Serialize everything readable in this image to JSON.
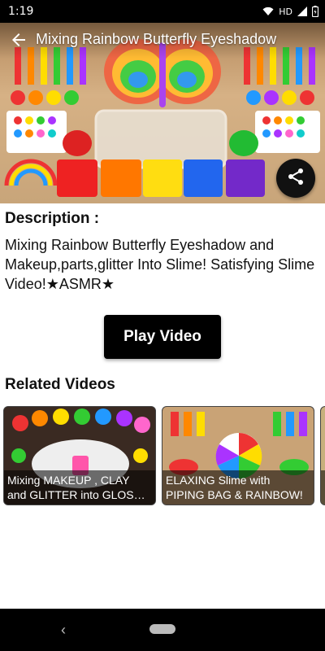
{
  "status_bar": {
    "time": "1:19",
    "network_label": "HD",
    "icons": [
      "wifi-icon",
      "hd-icon",
      "signal-icon",
      "battery-icon"
    ]
  },
  "header": {
    "title": "Mixing Rainbow Butterfly Eyeshadow",
    "back_icon": "arrow-left-icon",
    "share_icon": "share-icon"
  },
  "description": {
    "heading": "Description :",
    "text": "Mixing Rainbow Butterfly Eyeshadow and Makeup,parts,glitter Into Slime! Satisfying Slime Video!★ASMR★"
  },
  "play_button": {
    "label": "Play Video"
  },
  "related": {
    "heading": "Related Videos",
    "videos": [
      {
        "line1": "Mixing MAKEUP , CLAY",
        "line2": "and GLITTER into GLOSS…"
      },
      {
        "line1": "ELAXING Slime with",
        "line2": "PIPING BAG & RAINBOW!"
      },
      {
        "line1": "",
        "line2": ""
      }
    ]
  },
  "nav_bar": {
    "icons": [
      "nav-back-icon",
      "nav-home-pill"
    ]
  },
  "colors": {
    "status_bar": "#000000",
    "button": "#000000",
    "background": "#ffffff"
  }
}
